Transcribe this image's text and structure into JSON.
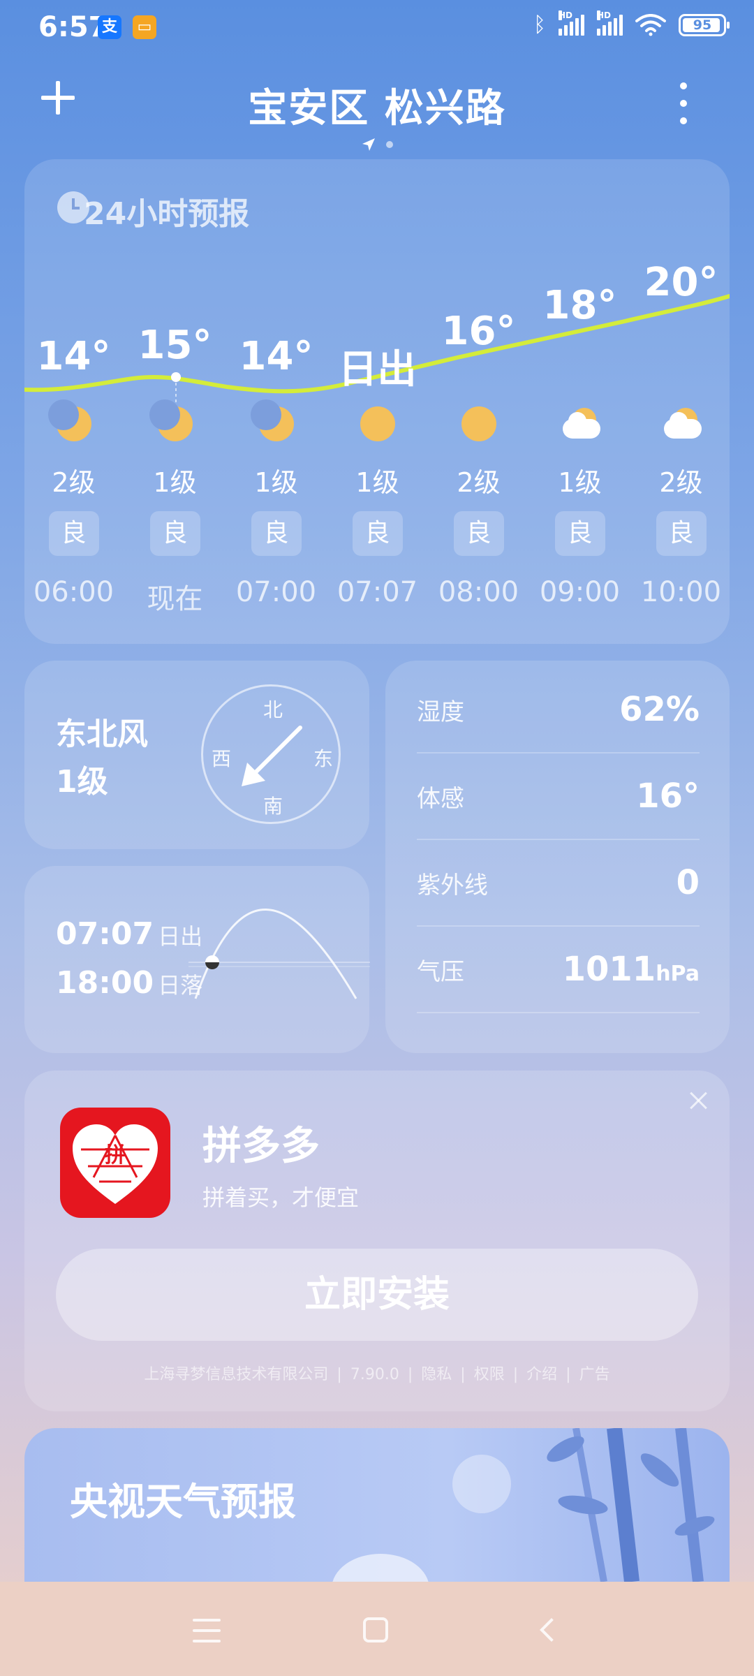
{
  "status_bar": {
    "time": "6:57",
    "app_icons": [
      "alipay-icon",
      "notes-icon"
    ],
    "battery": "95",
    "battery_level": 0.95,
    "signal_labels": [
      "HD",
      "HD"
    ]
  },
  "header": {
    "location": "宝安区 松兴路"
  },
  "hourly": {
    "title": "24小时预报",
    "items": [
      {
        "temp": "14°",
        "icon": "moon-icon",
        "wind": "2级",
        "aqi": "良",
        "time": "06:00"
      },
      {
        "temp": "15°",
        "icon": "moon-icon",
        "wind": "1级",
        "aqi": "良",
        "time": "现在"
      },
      {
        "temp": "14°",
        "icon": "moon-icon",
        "wind": "1级",
        "aqi": "良",
        "time": "07:00"
      },
      {
        "temp": "日出",
        "icon": "sun-icon",
        "wind": "1级",
        "aqi": "良",
        "time": "07:07"
      },
      {
        "temp": "16°",
        "icon": "sun-icon",
        "wind": "2级",
        "aqi": "良",
        "time": "08:00"
      },
      {
        "temp": "18°",
        "icon": "partly-cloudy-icon",
        "wind": "1级",
        "aqi": "良",
        "time": "09:00"
      },
      {
        "temp": "20°",
        "icon": "partly-cloudy-icon",
        "wind": "2级",
        "aqi": "良",
        "time": "10:00"
      }
    ]
  },
  "wind": {
    "direction": "东北风",
    "level": "1级",
    "compass": {
      "n": "北",
      "s": "南",
      "e": "东",
      "w": "西"
    }
  },
  "sun": {
    "sunrise_time": "07:07",
    "sunrise_label": "日出",
    "sunset_time": "18:00",
    "sunset_label": "日落"
  },
  "stats": {
    "humidity": {
      "label": "湿度",
      "value": "62%"
    },
    "feels_like": {
      "label": "体感",
      "value": "16°"
    },
    "uv": {
      "label": "紫外线",
      "value": "0"
    },
    "pressure": {
      "label": "气压",
      "value": "1011",
      "unit": "hPa"
    }
  },
  "ad": {
    "app_name": "拼多多",
    "slogan": "拼着买，才便宜",
    "install_label": "立即安装",
    "logo_char": "拼",
    "footer": {
      "company": "上海寻梦信息技术有限公司",
      "version": "7.90.0",
      "privacy": "隐私",
      "permissions": "权限",
      "intro": "介绍",
      "ad_label": "广告"
    }
  },
  "cctv": {
    "title": "央视天气预报"
  },
  "colors": {
    "curve": "#d4ec3a",
    "accent_sun": "#f4c05a",
    "ad_red": "#e5161f"
  }
}
